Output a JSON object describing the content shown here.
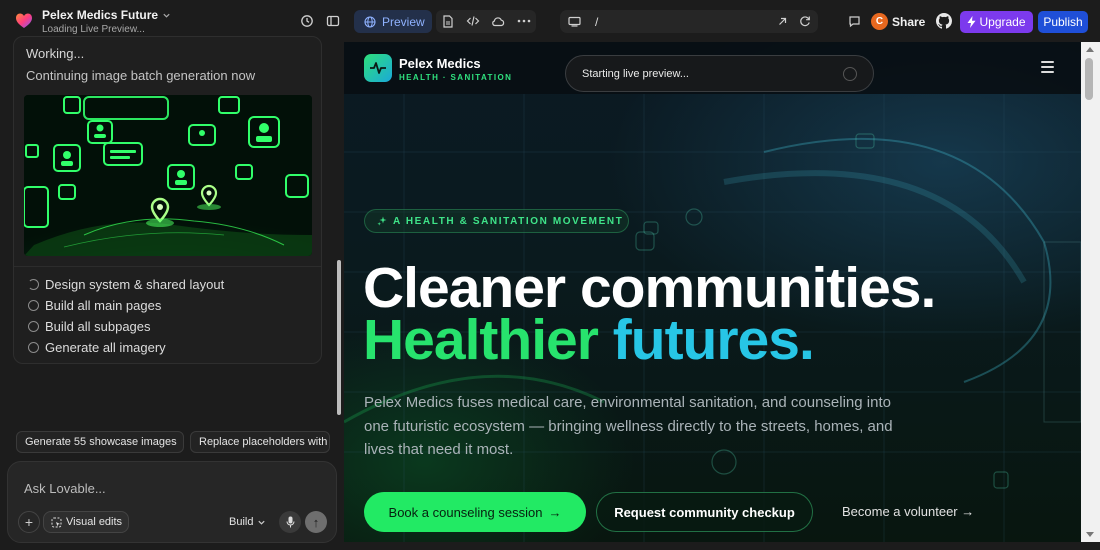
{
  "app": {
    "project_name": "Pelex Medics Future",
    "project_status": "Loading Live Preview...",
    "preview_tab": "Preview",
    "url_path": "/",
    "avatar_initial": "C",
    "share_label": "Share",
    "upgrade_label": "Upgrade",
    "publish_label": "Publish"
  },
  "chat": {
    "working": "Working...",
    "status_line": "Continuing image batch generation now",
    "tasks": [
      {
        "label": "Design system & shared layout",
        "state": "in-progress"
      },
      {
        "label": "Build all main pages",
        "state": "pending"
      },
      {
        "label": "Build all subpages",
        "state": "pending"
      },
      {
        "label": "Generate all imagery",
        "state": "pending"
      }
    ],
    "suggestions": [
      "Generate 55 showcase images",
      "Replace placeholders with"
    ],
    "composer_placeholder": "Ask Lovable...",
    "visual_edits_label": "Visual edits",
    "build_label": "Build"
  },
  "site": {
    "brand_name": "Pelex Medics",
    "brand_tagline": "HEALTH · SANITATION",
    "toast": "Starting live preview...",
    "eyebrow": "A HEALTH & SANITATION MOVEMENT",
    "headline_line1": "Cleaner communities.",
    "headline_word1": "Healthier",
    "headline_word2": "futures.",
    "lead": "Pelex Medics fuses medical care, environmental sanitation, and counseling into one futuristic ecosystem — bringing wellness directly to the streets, homes, and lives that need it most.",
    "cta_primary": "Book a counseling session",
    "cta_primary_arrow": "→",
    "cta_secondary": "Request community checkup",
    "cta_tertiary": "Become a volunteer →"
  },
  "colors": {
    "accent_green": "#22ea64",
    "accent_cyan": "#27c6e6",
    "upgrade_purple": "#7c3aed",
    "publish_blue": "#1f4fd8",
    "avatar_orange": "#e8681f"
  }
}
